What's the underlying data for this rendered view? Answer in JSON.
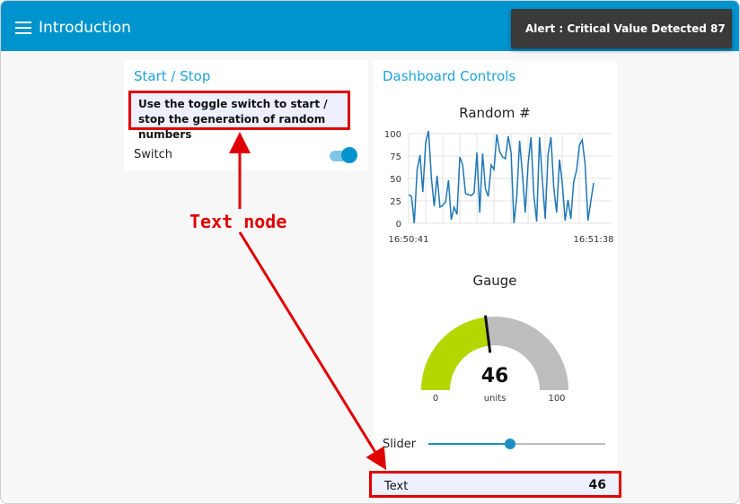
{
  "header": {
    "title": "Introduction"
  },
  "toast": {
    "text": "Alert : Critical Value Detected 87"
  },
  "left_group": {
    "title": "Start / Stop",
    "text_node": "Use the toggle switch to start / stop the generation of random numbers",
    "switch_label": "Switch",
    "switch_on": true
  },
  "right_group": {
    "title": "Dashboard Controls",
    "gauge": {
      "title": "Gauge",
      "value": "46",
      "units": "units",
      "min": "0",
      "max": "100",
      "value_num": 46,
      "min_num": 0,
      "max_num": 100
    },
    "slider": {
      "label": "Slider",
      "value": 46,
      "min": 0,
      "max": 100
    },
    "text_widget": {
      "label": "Text",
      "value": "46"
    }
  },
  "annotation": {
    "label": "Text node"
  },
  "colors": {
    "accent": "#0094ce",
    "gauge_fill": "#b6d600",
    "gauge_bg": "#bdbdbd",
    "highlight": "#e00000",
    "line": "#1f77b4"
  },
  "chart_data": {
    "type": "line",
    "title": "Random #",
    "x_start": "16:50:41",
    "x_end": "16:51:38",
    "yticks": [
      "100",
      "75",
      "50",
      "25",
      "0"
    ],
    "ylim": [
      0,
      100
    ],
    "grid": true,
    "series": [
      {
        "values": [
          32,
          30,
          0,
          60,
          76,
          35,
          90,
          103,
          50,
          19,
          53,
          18,
          20,
          24,
          48,
          4,
          18,
          10,
          74,
          65,
          33,
          32,
          31,
          34,
          79,
          12,
          78,
          38,
          30,
          65,
          60,
          99,
          80,
          74,
          72,
          97,
          79,
          0,
          29,
          92,
          54,
          12,
          67,
          96,
          32,
          2,
          96,
          47,
          5,
          77,
          96,
          40,
          12,
          71,
          45,
          3,
          26,
          5,
          46,
          59,
          87,
          93,
          66,
          3,
          24,
          45
        ]
      }
    ]
  }
}
